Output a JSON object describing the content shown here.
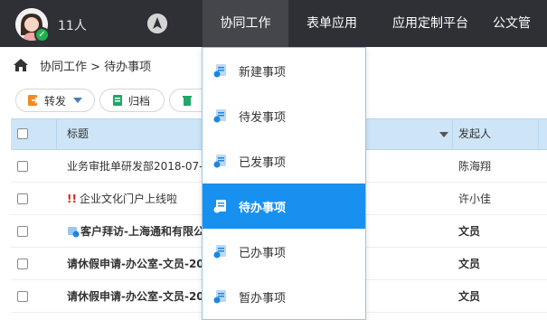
{
  "topbar": {
    "user_count": "11人",
    "nav": [
      {
        "label": "协同工作",
        "active": true
      },
      {
        "label": "表单应用",
        "active": false
      },
      {
        "label": "应用定制平台",
        "active": false
      },
      {
        "label": "公文管"
      }
    ]
  },
  "breadcrumb": {
    "text": "协同工作 > 待办事项"
  },
  "toolbar": {
    "forward_label": "转发",
    "archive_label": "归档"
  },
  "table": {
    "headers": {
      "title": "标题",
      "initiator": "发起人"
    },
    "rows": [
      {
        "title": "业务审批单研发部2018-07-",
        "initiator": "陈海翔",
        "bold": false,
        "flag": "",
        "icon": false
      },
      {
        "title": "企业文化门户上线啦",
        "initiator": "许小佳",
        "bold": false,
        "flag": "!!",
        "icon": false
      },
      {
        "title": "客户拜访-上海通和有限公",
        "initiator": "文员",
        "bold": true,
        "flag": "",
        "icon": true
      },
      {
        "title": "请休假申请-办公室-文员-20",
        "initiator": "文员",
        "bold": true,
        "flag": "",
        "icon": false
      },
      {
        "title": "请休假申请-办公室-文员-20",
        "initiator": "文员",
        "bold": true,
        "flag": "",
        "icon": false
      }
    ]
  },
  "dropdown": {
    "items": [
      {
        "label": "新建事项",
        "active": false
      },
      {
        "label": "待发事项",
        "active": false
      },
      {
        "label": "已发事项",
        "active": false
      },
      {
        "label": "待办事项",
        "active": true
      },
      {
        "label": "已办事项",
        "active": false
      },
      {
        "label": "暂办事项",
        "active": false
      }
    ]
  },
  "colors": {
    "nav_bg": "#2f3035",
    "accent": "#1790f0",
    "header_bg": "#cde5f7"
  },
  "icons": [
    "avatar",
    "compass-icon",
    "home-icon",
    "forward-icon",
    "archive-icon",
    "trash-icon",
    "checkbox",
    "sort-arrow-icon",
    "task-list-icon"
  ]
}
